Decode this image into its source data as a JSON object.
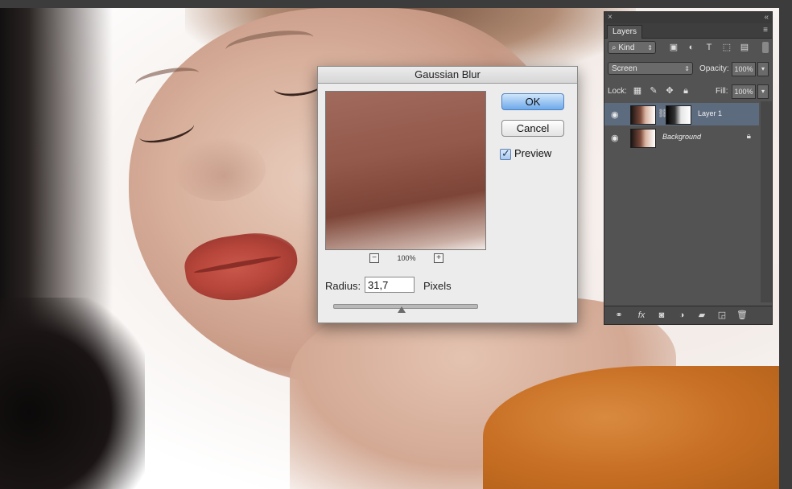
{
  "dialog": {
    "title": "Gaussian Blur",
    "ok_label": "OK",
    "cancel_label": "Cancel",
    "preview_label": "Preview",
    "preview_checked": true,
    "zoom_level": "100%",
    "zoom_minus": "−",
    "zoom_plus": "+",
    "radius_label": "Radius:",
    "radius_value": "31,7",
    "radius_unit": "Pixels"
  },
  "layers_panel": {
    "close_glyph": "×",
    "collapse_glyph": "«",
    "tab_label": "Layers",
    "menu_glyph": "≡",
    "filter_kind": "Kind",
    "filter_search_glyph": "⌕",
    "blend_mode": "Screen",
    "opacity_label": "Opacity:",
    "opacity_value": "100%",
    "lock_label": "Lock:",
    "fill_label": "Fill:",
    "fill_value": "100%",
    "layers": [
      {
        "name": "Layer 1",
        "selected": true,
        "has_mask": true
      },
      {
        "name": "Background",
        "selected": false,
        "locked": true
      }
    ],
    "icons": {
      "filter_pixel": "pixel-filter-icon",
      "filter_adjust": "adjustment-filter-icon",
      "filter_type": "type-filter-icon",
      "filter_shape": "shape-filter-icon",
      "filter_smart": "smart-object-filter-icon",
      "lock_pixels": "lock-transparent-icon",
      "lock_paint": "lock-paint-icon",
      "lock_move": "lock-position-icon",
      "lock_all": "lock-all-icon",
      "bottom": [
        "link-icon",
        "fx-icon",
        "mask-icon",
        "adjustment-icon",
        "folder-icon",
        "new-layer-icon",
        "trash-icon"
      ]
    }
  },
  "colors": {
    "panel_bg": "#535353",
    "selected_layer": "#5d6b7f",
    "ok_button": "#6ea9ea",
    "shirt": "#c76f24",
    "lips": "#b8463b"
  }
}
